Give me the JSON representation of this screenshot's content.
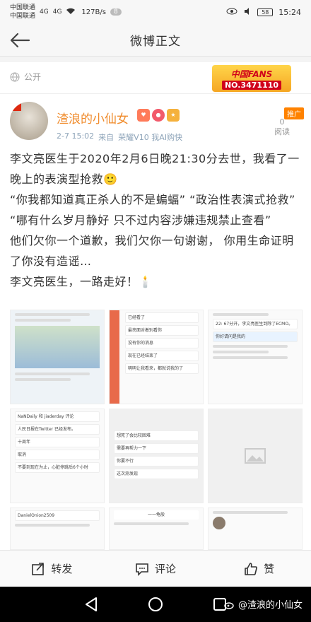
{
  "status_bar": {
    "carrier1": "中国联通",
    "carrier2": "中国联通",
    "sig1": "4G",
    "sig2": "4G",
    "speed": "127B/s",
    "notif_count": "8",
    "battery": "58",
    "time": "15:24"
  },
  "nav": {
    "title": "微博正文"
  },
  "post": {
    "visibility": "公开",
    "fans_badge": {
      "top": "中国FANS",
      "number": "NO.3471110"
    },
    "user_name": "渣浪的小仙女",
    "time": "2-7 15:02",
    "source_prefix": "来自",
    "source": "荣耀V10 我AI购快",
    "promo_tag": "推广",
    "read_count": "0",
    "read_label": "阅读",
    "paragraphs": [
      "李文亮医生于2020年2月6日晚21:30分去世，我看了一晚上的表演型抢救🙂",
      "“你我都知道真正杀人的不是蝙蝠” “政治性表演式抢救” “哪有什么岁月静好 只不过内容涉嫌违规禁止查看”",
      "他们欠你一个道歉，我们欠你一句谢谢， 你用生命证明了你没有造谣…",
      "李文亮医生，一路走好！🕯️"
    ],
    "thumbs": {
      "t1_text": "",
      "t2_msgs": [
        "已经看了",
        "最亮面对着别看你",
        "没有你的消息",
        "现在已经结束了",
        "明明让我看来，都就说我的了"
      ],
      "t3_msgs": [
        "22: 67分开，李文亮医生到除了ECMO。",
        "你好请问是我的"
      ],
      "t4_header": "NaNDaily 和 jiaderday 评论",
      "t4_msgs": [
        "人民日报在Twitter 已经发布。",
        "十周年",
        "取消",
        "发表评论",
        "不要到现在为止，心脏停跳后6个小时"
      ],
      "t5_msgs": [
        "想死了会比较困难",
        "需要再帮力一下",
        "你要不行",
        "这次测发现"
      ],
      "t7_header": "DanielOnion2509",
      "t8_header": "一一龟般"
    }
  },
  "actions": {
    "repost": "转发",
    "comment": "评论",
    "like": "赞"
  },
  "watermark": "@渣浪的小仙女",
  "colors": {
    "accent": "#f08b2b",
    "meta": "#8ea4b9",
    "promo": "#ff8200"
  }
}
